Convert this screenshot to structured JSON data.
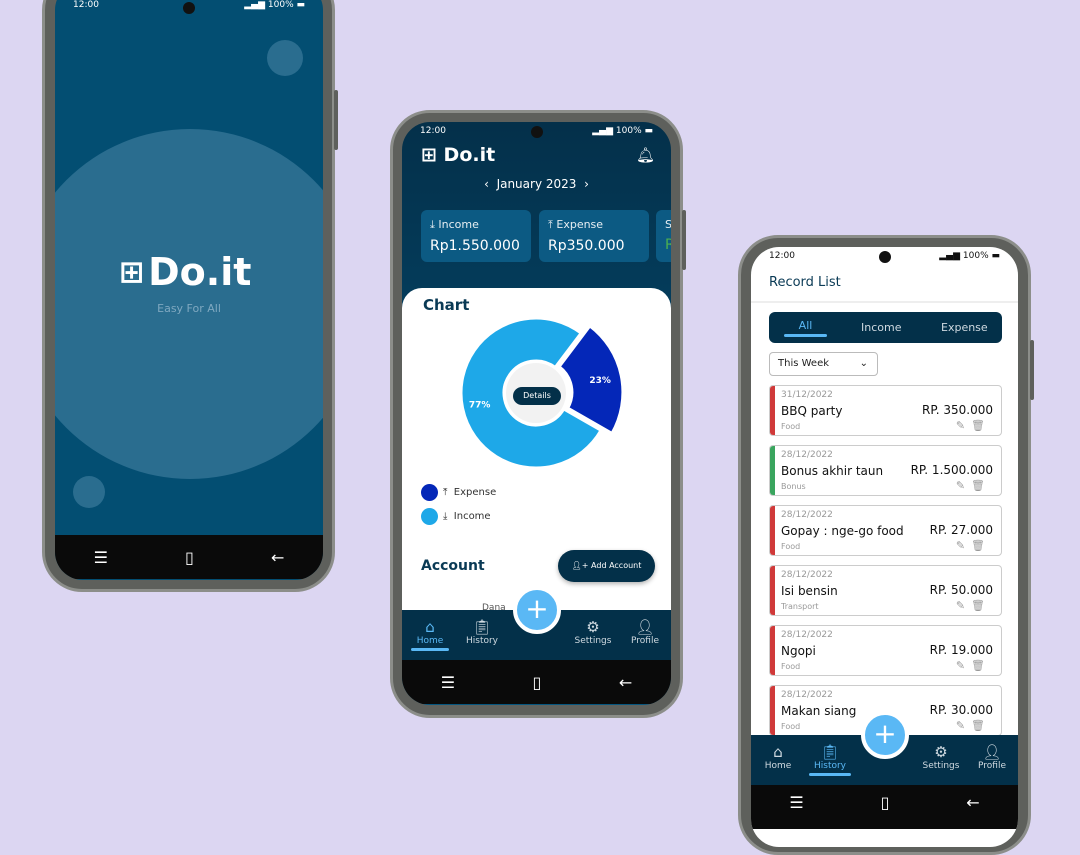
{
  "status": {
    "time": "12:00",
    "battery": "100%"
  },
  "splash": {
    "logo": "Do.it",
    "tagline": "Easy For All"
  },
  "home": {
    "app_title": "Do.it",
    "month": "January 2023",
    "cards": [
      {
        "label": "Income",
        "value": "Rp1.550.000",
        "icon": "download-icon"
      },
      {
        "label": "Expense",
        "value": "Rp350.000",
        "icon": "upload-icon"
      },
      {
        "label": "S",
        "value": "R"
      }
    ],
    "chart_title": "Chart",
    "details_label": "Details",
    "account_title": "Account",
    "add_account_label": "Add Account",
    "account_peek": "Dana"
  },
  "chart_data": {
    "type": "pie",
    "donut": true,
    "categories": [
      "Expense",
      "Income"
    ],
    "values": [
      23,
      77
    ],
    "labels": [
      "23%",
      "77%"
    ],
    "colors": [
      "#0427b8",
      "#1ea8e8"
    ]
  },
  "legend": [
    {
      "label": "Expense",
      "color": "#0427b8"
    },
    {
      "label": "Income",
      "color": "#1ea8e8"
    }
  ],
  "nav": {
    "home": "Home",
    "history": "History",
    "settings": "Settings",
    "profile": "Profile"
  },
  "records": {
    "title": "Record List",
    "tabs": [
      "All",
      "Income",
      "Expense"
    ],
    "filter": "This Week",
    "items": [
      {
        "date": "31/12/2022",
        "title": "BBQ party",
        "category": "Food",
        "amount": "RP. 350.000",
        "type": "expense"
      },
      {
        "date": "28/12/2022",
        "title": "Bonus akhir taun",
        "category": "Bonus",
        "amount": "RP. 1.500.000",
        "type": "income"
      },
      {
        "date": "28/12/2022",
        "title": "Gopay : nge-go food",
        "category": "Food",
        "amount": "RP. 27.000",
        "type": "expense"
      },
      {
        "date": "28/12/2022",
        "title": "Isi bensin",
        "category": "Transport",
        "amount": "RP. 50.000",
        "type": "expense"
      },
      {
        "date": "28/12/2022",
        "title": "Ngopi",
        "category": "Food",
        "amount": "RP. 19.000",
        "type": "expense"
      },
      {
        "date": "28/12/2022",
        "title": "Makan siang",
        "category": "Food",
        "amount": "RP. 30.000",
        "type": "expense"
      }
    ]
  },
  "colors": {
    "background": "#dcd6f2",
    "primary": "#033049",
    "accent": "#5ab8f5",
    "expense": "#d03a3a",
    "income": "#3aa55e"
  }
}
